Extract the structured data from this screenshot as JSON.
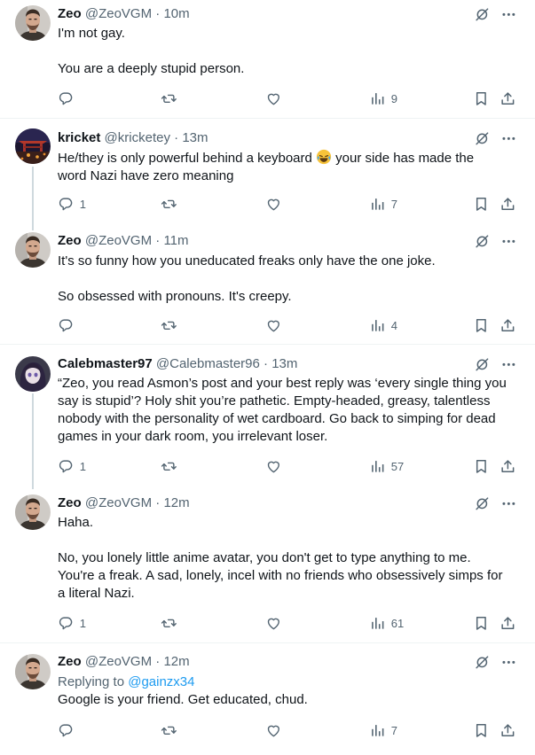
{
  "tweets": [
    {
      "name": "Zeo",
      "handle": "@ZeoVGM",
      "time": "10m",
      "lines": [
        "I'm not gay.",
        "You are a deeply stupid person."
      ],
      "replies": "",
      "views": "9"
    },
    {
      "name": "kricket",
      "handle": "@kricketey",
      "time": "13m",
      "line1a": "He/they is only powerful behind a keyboard",
      "line1b": " your side has made the",
      "line2": "word Nazi have zero meaning",
      "replies": "1",
      "views": "7"
    },
    {
      "name": "Zeo",
      "handle": "@ZeoVGM",
      "time": "11m",
      "lines": [
        "It's so funny how you uneducated freaks only have the one joke.",
        "So obsessed with pronouns. It's creepy."
      ],
      "replies": "",
      "views": "4"
    },
    {
      "name": "Calebmaster97",
      "handle": "@Calebmaster96",
      "time": "13m",
      "lines": [
        "“Zeo, you read Asmon’s post and your best reply was ‘every single thing you",
        "say is stupid’? Holy shit you’re pathetic. Empty-headed, greasy, talentless",
        "nobody with the personality of wet cardboard. Go back to simping for dead",
        "games in your dark room, you irrelevant loser."
      ],
      "replies": "1",
      "views": "57"
    },
    {
      "name": "Zeo",
      "handle": "@ZeoVGM",
      "time": "12m",
      "lines": [
        "Haha.",
        "No, you lonely little anime avatar, you don't get to type anything to me.",
        "You're a freak. A sad, lonely, incel with no friends who obsessively simps for",
        "a literal Nazi."
      ],
      "replies": "1",
      "views": "61"
    },
    {
      "name": "Zeo",
      "handle": "@ZeoVGM",
      "time": "12m",
      "replying_prefix": "Replying to ",
      "replying_handle": "@gainzx34",
      "lines": [
        "Google is your friend. Get educated, chud."
      ],
      "replies": "",
      "views": "7"
    }
  ],
  "dot": "·",
  "icons": [
    "no-bell-icon",
    "more-icon",
    "reply-icon",
    "retweet-icon",
    "like-icon",
    "views-icon",
    "bookmark-icon",
    "share-icon",
    "laughing-emoji"
  ]
}
